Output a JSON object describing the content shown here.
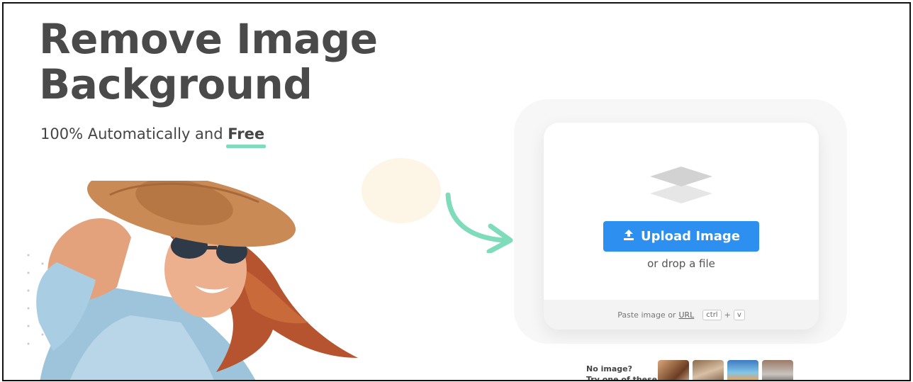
{
  "hero": {
    "title_line1": "Remove Image",
    "title_line2": "Background",
    "subtitle_prefix": "100% Automatically and",
    "subtitle_highlight": "Free"
  },
  "upload": {
    "button_label": "Upload Image",
    "drop_text": "or drop a file",
    "paste_text": "Paste image or",
    "url_link": "URL",
    "shortcut_key1": "ctrl",
    "shortcut_plus": "+",
    "shortcut_key2": "v"
  },
  "samples": {
    "prompt_line1": "No image?",
    "prompt_line2": "Try one of these:"
  },
  "colors": {
    "accent": "#2d8ff0",
    "highlight": "#7fdcbb",
    "heading": "#4a4a4a"
  },
  "icons": [
    "layers-icon",
    "upload-icon",
    "curved-arrow-icon"
  ]
}
